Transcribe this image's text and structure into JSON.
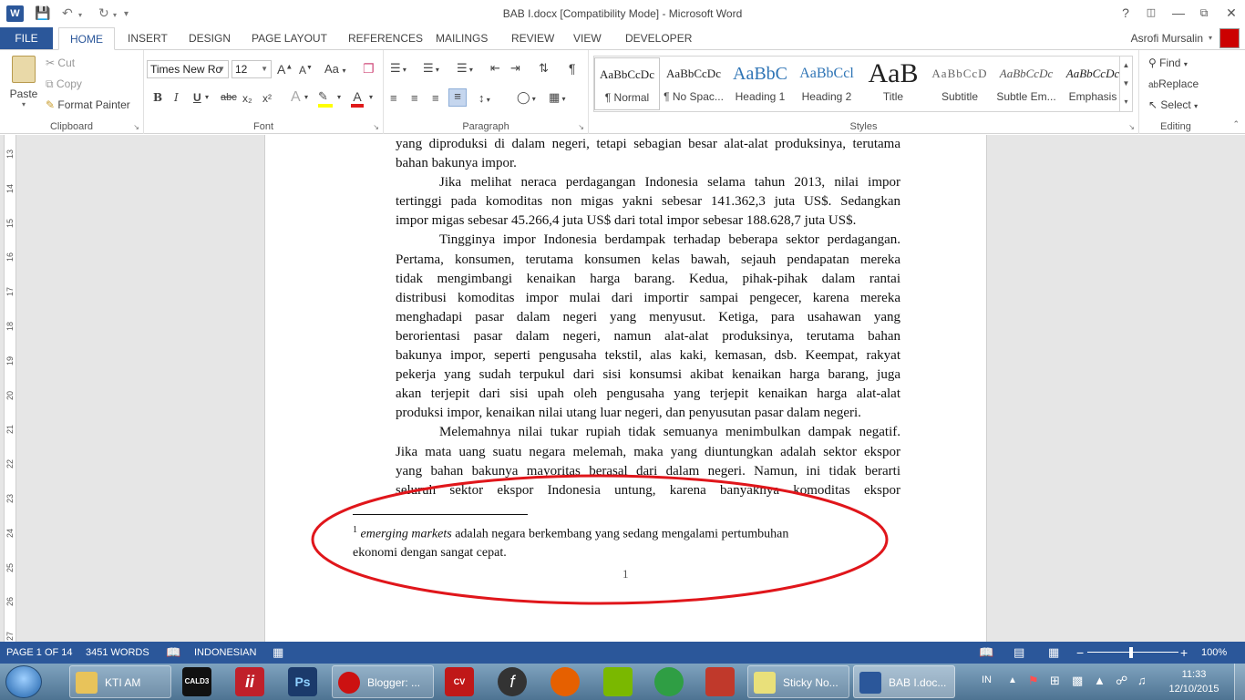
{
  "window": {
    "title": "BAB I.docx [Compatibility Mode] - Microsoft Word",
    "help": "?",
    "app_icon": "W"
  },
  "tabs": {
    "file": "FILE",
    "items": [
      "HOME",
      "INSERT",
      "DESIGN",
      "PAGE LAYOUT",
      "REFERENCES",
      "MAILINGS",
      "REVIEW",
      "VIEW",
      "DEVELOPER"
    ],
    "active": "HOME",
    "user": "Asrofi Mursalin"
  },
  "clipboard": {
    "paste": "Paste",
    "cut": "Cut",
    "copy": "Copy",
    "format_painter": "Format Painter",
    "label": "Clipboard"
  },
  "font": {
    "family": "Times New Ro",
    "size": "12",
    "label": "Font",
    "bold": "B",
    "italic": "I",
    "underline": "U",
    "strike": "abc",
    "subscript": "x₂",
    "superscript": "x²",
    "grow": "A",
    "shrink": "A",
    "case": "Aa"
  },
  "paragraph": {
    "label": "Paragraph"
  },
  "styles": {
    "label": "Styles",
    "items": [
      {
        "sample": "AaBbCcDc",
        "name": "¶ Normal"
      },
      {
        "sample": "AaBbCcDc",
        "name": "¶ No Spac..."
      },
      {
        "sample": "AaBbC",
        "name": "Heading 1"
      },
      {
        "sample": "AaBbCcl",
        "name": "Heading 2"
      },
      {
        "sample": "AaB",
        "name": "Title"
      },
      {
        "sample": "AaBbCcD",
        "name": "Subtitle"
      },
      {
        "sample": "AaBbCcDc",
        "name": "Subtle Em..."
      },
      {
        "sample": "AaBbCcDc",
        "name": "Emphasis"
      }
    ]
  },
  "editing": {
    "label": "Editing",
    "find": "Find",
    "replace": "Replace",
    "select": "Select"
  },
  "ruler": {
    "numbers": [
      "13",
      "14",
      "15",
      "16",
      "17",
      "18",
      "19",
      "20",
      "21",
      "22",
      "23",
      "24",
      "25",
      "26",
      "27"
    ]
  },
  "document": {
    "p1_lines": [
      "yang diproduksi di dalam negeri, tetapi sebagian besar alat-alat produksinya, terutama",
      "bahan bakunya impor."
    ],
    "p2_lines": [
      "Jika melihat neraca perdagangan Indonesia selama tahun 2013, nilai impor",
      "tertinggi pada komoditas non migas yakni sebesar 141.362,3 juta US$. Sedangkan",
      "impor migas sebesar 45.266,4 juta US$ dari total impor sebesar 188.628,7 juta US$."
    ],
    "p3_lines": [
      "Tingginya impor Indonesia berdampak terhadap beberapa sektor perdagangan.",
      "Pertama, konsumen, terutama konsumen kelas bawah, sejauh pendapatan mereka",
      "tidak mengimbangi kenaikan harga barang. Kedua, pihak-pihak dalam rantai",
      "distribusi komoditas impor mulai dari importir sampai pengecer, karena mereka",
      "menghadapi pasar dalam negeri yang menyusut. Ketiga, para usahawan yang",
      "berorientasi pasar dalam negeri, namun alat-alat produksinya, terutama bahan",
      "bakunya impor, seperti pengusaha tekstil, alas kaki, kemasan, dsb. Keempat, rakyat",
      "pekerja yang sudah terpukul dari sisi konsumsi akibat kenaikan harga barang, juga",
      "akan terjepit dari sisi upah oleh pengusaha yang terjepit kenaikan harga alat-alat",
      "produksi impor, kenaikan nilai utang luar negeri, dan penyusutan pasar dalam negeri."
    ],
    "p4_lines": [
      "Melemahnya nilai tukar rupiah tidak semuanya menimbulkan dampak negatif.",
      "Jika mata uang suatu negara melemah, maka yang diuntungkan adalah sektor ekspor",
      "yang bahan bakunya mayoritas berasal dari dalam negeri. Namun, ini tidak berarti",
      "seluruh sektor ekspor Indonesia untung, karena banyaknya komoditas ekspor"
    ],
    "footnote_mark": "1",
    "footnote_term": "emerging markets",
    "footnote_text": " adalah negara berkembang yang sedang mengalami pertumbuhan",
    "footnote_line2": "ekonomi dengan sangat cepat.",
    "page_number": "1",
    "annotation_color": "#e0161b"
  },
  "status": {
    "page": "PAGE 1 OF 14",
    "words": "3451 WORDS",
    "language": "INDONESIAN",
    "zoom": "100%"
  },
  "taskbar": {
    "buttons": [
      {
        "label": "KTI AM",
        "icon_color": "#e8c35a"
      },
      {
        "label": "Blogger: ...",
        "icon_color": "#cc1111"
      },
      {
        "label": "Sticky No...",
        "icon_color": "#e9e07a"
      },
      {
        "label": "BAB I.doc...",
        "icon_color": "#2b579a"
      }
    ],
    "pins": [
      {
        "name": "cald3",
        "text": "CALD3",
        "color": "#111"
      },
      {
        "name": "app-ii",
        "text": "ii",
        "color": "#c0202a"
      },
      {
        "name": "photoshop",
        "text": "Ps",
        "color": "#1b3a6b"
      },
      {
        "name": "cvavr",
        "text": "CV AVR",
        "color": "#c01818"
      },
      {
        "name": "flash",
        "text": "f",
        "color": "#333"
      },
      {
        "name": "firefox",
        "text": "",
        "color": "#e66000"
      },
      {
        "name": "evernote",
        "text": "",
        "color": "#7ab800"
      },
      {
        "name": "chrome",
        "text": "",
        "color": "#2f9e44"
      },
      {
        "name": "book",
        "text": "",
        "color": "#c0392b"
      }
    ],
    "lang": "IN",
    "time": "11:33",
    "date": "12/10/2015"
  }
}
